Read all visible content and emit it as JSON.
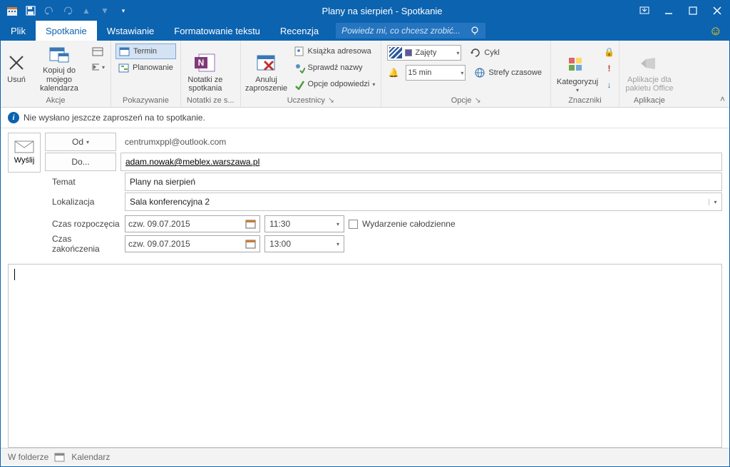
{
  "window": {
    "title": "Plany na sierpień - Spotkanie"
  },
  "tabs": {
    "file": "Plik",
    "meeting": "Spotkanie",
    "insert": "Wstawianie",
    "format": "Formatowanie tekstu",
    "review": "Recenzja",
    "tellme": "Powiedz mi, co chcesz zrobić..."
  },
  "ribbon": {
    "actions": {
      "delete": "Usuń",
      "copy": "Kopiuj do mojego kalendarza",
      "group": "Akcje"
    },
    "show": {
      "appointment": "Termin",
      "scheduling": "Planowanie",
      "group": "Pokazywanie"
    },
    "notes": {
      "label": "Notatki ze spotkania",
      "group": "Notatki ze s..."
    },
    "attendees": {
      "cancel": "Anuluj zaproszenie",
      "addressbook": "Książka adresowa",
      "checknames": "Sprawdź nazwy",
      "responses": "Opcje odpowiedzi",
      "group": "Uczestnicy"
    },
    "options": {
      "busy": "Zajęty",
      "recurrence": "Cykl",
      "reminder": "15 min",
      "timezones": "Strefy czasowe",
      "group": "Opcje"
    },
    "tags": {
      "categorize": "Kategoryzuj",
      "group": "Znaczniki"
    },
    "apps": {
      "label": "Aplikacje dla pakietu Office",
      "group": "Aplikacje"
    }
  },
  "info": "Nie wysłano jeszcze zaproszeń na to spotkanie.",
  "form": {
    "send": "Wyślij",
    "from_label": "Od",
    "from_value": "centrumxppl@outlook.com",
    "to_label": "Do...",
    "to_value": "adam.nowak@meblex.warszawa.pl",
    "subject_label": "Temat",
    "subject_value": "Plany na sierpień",
    "location_label": "Lokalizacja",
    "location_value": "Sala konferencyjna 2",
    "start_label": "Czas rozpoczęcia",
    "start_date": "czw. 09.07.2015",
    "start_time": "11:30",
    "end_label": "Czas zakończenia",
    "end_date": "czw. 09.07.2015",
    "end_time": "13:00",
    "allday": "Wydarzenie całodzienne"
  },
  "status": {
    "infolder": "W folderze",
    "calendar": "Kalendarz"
  }
}
